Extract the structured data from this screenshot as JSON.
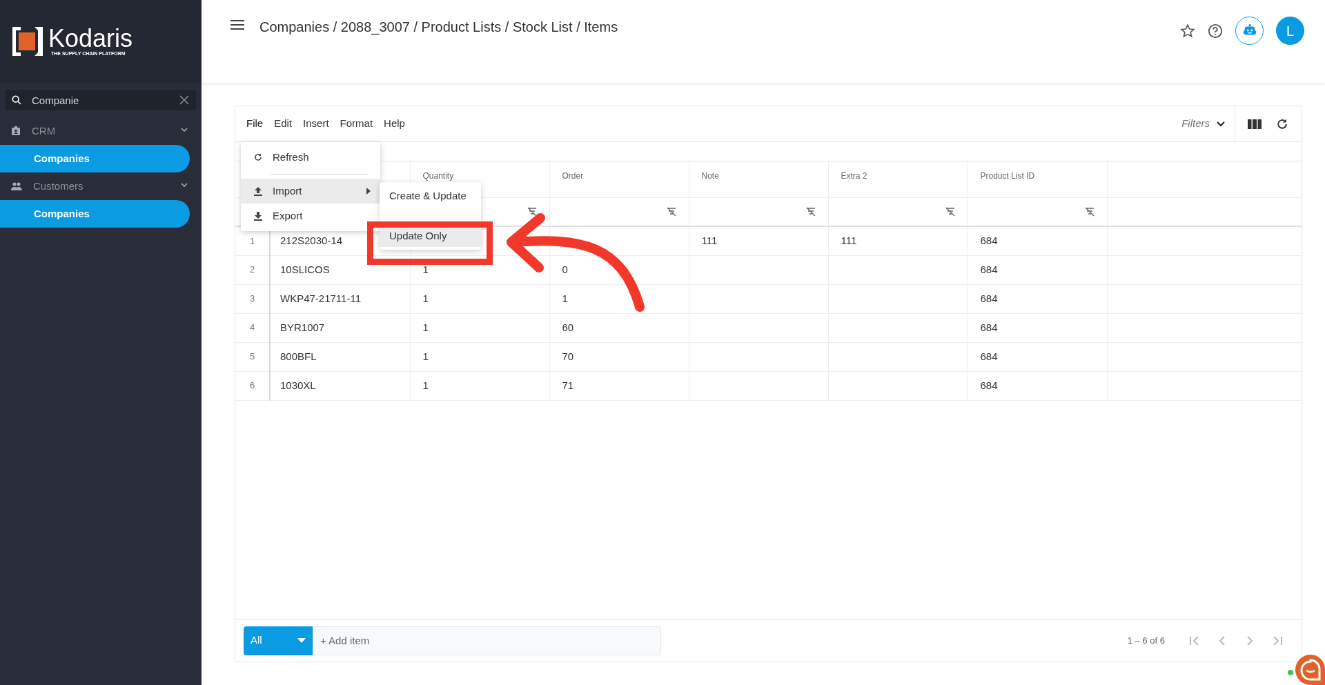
{
  "sidebar": {
    "logo": {
      "name": "Kodaris",
      "tagline": "THE SUPPLY CHAIN PLATFORM"
    },
    "search": {
      "value": "Companie"
    },
    "groups": [
      {
        "label": "CRM",
        "expanded": true,
        "children": [
          {
            "label": "Companies",
            "selected": true
          }
        ]
      },
      {
        "label": "Customers",
        "expanded": true,
        "children": [
          {
            "label": "Companies",
            "selected": true
          }
        ]
      }
    ]
  },
  "header": {
    "breadcrumb": "Companies / 2088_3007 / Product Lists / Stock List / Items",
    "avatar": "L"
  },
  "menubar": [
    {
      "label": "File",
      "open": true
    },
    {
      "label": "Edit",
      "open": false
    },
    {
      "label": "Insert",
      "open": false
    },
    {
      "label": "Format",
      "open": false
    },
    {
      "label": "Help",
      "open": false
    }
  ],
  "file_menu": [
    {
      "label": "Refresh",
      "kind": "refresh",
      "selected": false
    },
    {
      "label": "Import",
      "kind": "import",
      "selected": true
    },
    {
      "label": "Export",
      "kind": "export",
      "selected": false
    }
  ],
  "submenu": [
    {
      "label": "Create & Update",
      "selected": false
    },
    {
      "label": "Update Only",
      "selected": true
    }
  ],
  "toolbar": {
    "filters": "Filters"
  },
  "table": {
    "columns": [
      "Quantity",
      "Order",
      "Note",
      "Extra 2",
      "Product List ID"
    ],
    "rows": [
      {
        "number": "1",
        "item": "212S2030-14",
        "note": "111",
        "extra_2": "111",
        "product_list_id": "684"
      },
      {
        "number": "2",
        "item": "10SLICOS",
        "quantity": "1",
        "order": "0",
        "product_list_id": "684"
      },
      {
        "number": "3",
        "item": "WKP47-21711-11",
        "quantity": "1",
        "order": "1",
        "product_list_id": "684"
      },
      {
        "number": "4",
        "item": "BYR1007",
        "quantity": "1",
        "order": "60",
        "product_list_id": "684"
      },
      {
        "number": "5",
        "item": "800BFL",
        "quantity": "1",
        "order": "70",
        "product_list_id": "684"
      },
      {
        "number": "6",
        "item": "1030XL",
        "quantity": "1",
        "order": "71",
        "product_list_id": "684"
      }
    ]
  },
  "footer": {
    "scope": "All",
    "add_placeholder": "+ Add item",
    "pagination": "1 – 6 of 6"
  }
}
